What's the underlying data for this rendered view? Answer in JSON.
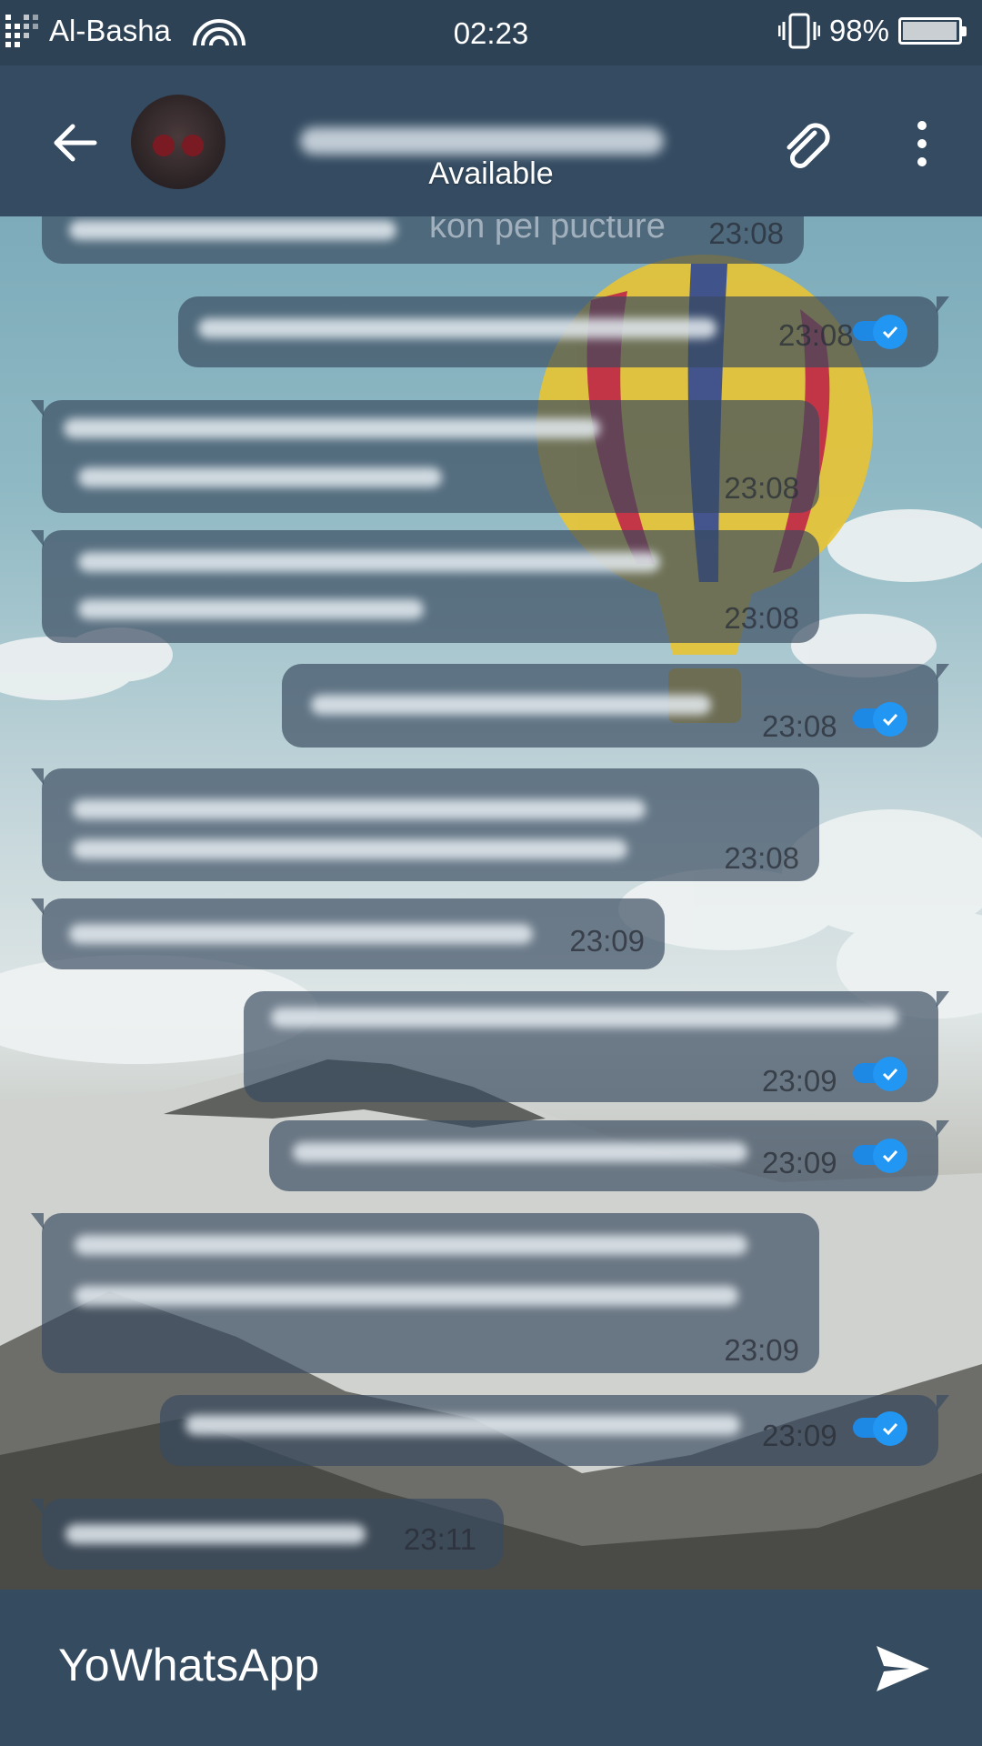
{
  "status_bar": {
    "carrier": "Al-Basha",
    "time": "02:23",
    "battery_percent": "98%",
    "battery_level": 0.98,
    "icons": [
      "signal-icon",
      "wifi-icon",
      "vibrate-icon",
      "battery-icon"
    ]
  },
  "header": {
    "contact_name": "",
    "contact_status": "Available",
    "icons": [
      "back-arrow-icon",
      "avatar",
      "attach-icon",
      "more-options-icon"
    ]
  },
  "messages": [
    {
      "direction": "in",
      "time": "23:08",
      "status": "",
      "partial_text": "kon pel pucture"
    },
    {
      "direction": "out",
      "time": "23:08",
      "status": "read"
    },
    {
      "direction": "in",
      "time": "23:08",
      "status": ""
    },
    {
      "direction": "in",
      "time": "23:08",
      "status": ""
    },
    {
      "direction": "out",
      "time": "23:08",
      "status": "read"
    },
    {
      "direction": "in",
      "time": "23:08",
      "status": ""
    },
    {
      "direction": "in",
      "time": "23:09",
      "status": ""
    },
    {
      "direction": "out",
      "time": "23:09",
      "status": "read"
    },
    {
      "direction": "out",
      "time": "23:09",
      "status": "read"
    },
    {
      "direction": "in",
      "time": "23:09",
      "status": ""
    },
    {
      "direction": "out",
      "time": "23:09",
      "status": "read"
    },
    {
      "direction": "in",
      "time": "23:11",
      "status": ""
    }
  ],
  "input": {
    "placeholder": "YoWhatsApp",
    "send_icon": "send-icon"
  },
  "colors": {
    "status_bar_bg": "#2e4256",
    "app_bar_bg": "#344b61",
    "bubble_bg": "#384a5f",
    "tick_blue": "#2196f3",
    "input_bar_bg": "#354b60"
  }
}
